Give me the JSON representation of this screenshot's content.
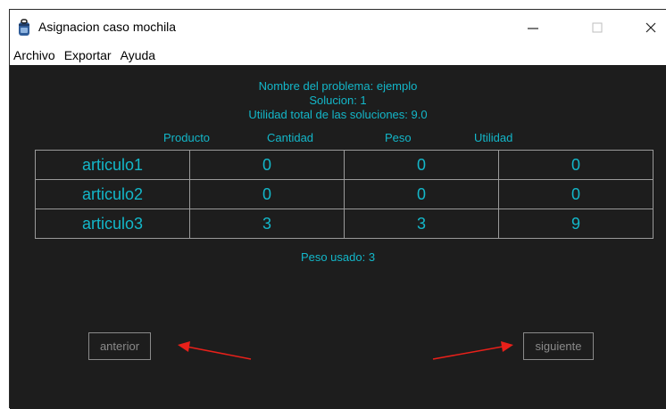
{
  "window": {
    "title": "Asignacion caso mochila",
    "controls": {
      "minimize": "—",
      "maximize": "☐",
      "close": "✕"
    }
  },
  "menu": {
    "items": [
      "Archivo",
      "Exportar",
      "Ayuda"
    ]
  },
  "content": {
    "problem_name": "Nombre del problema: ejemplo",
    "solution": "Solucion: 1",
    "total_utility": "Utilidad total de las soluciones: 9.0",
    "headers": [
      "Producto",
      "Cantidad",
      "Peso",
      "Utilidad"
    ],
    "rows": [
      [
        "articulo1",
        "0",
        "0",
        "0"
      ],
      [
        "articulo2",
        "0",
        "0",
        "0"
      ],
      [
        "articulo3",
        "3",
        "3",
        "9"
      ]
    ],
    "weight_used": "Peso usado: 3"
  },
  "buttons": {
    "previous": "anterior",
    "next": "siguiente"
  },
  "colors": {
    "accent": "#13b7c9",
    "background": "#1d1d1d",
    "arrow": "#e8201a"
  },
  "icons": {
    "app": "backpack-icon"
  }
}
